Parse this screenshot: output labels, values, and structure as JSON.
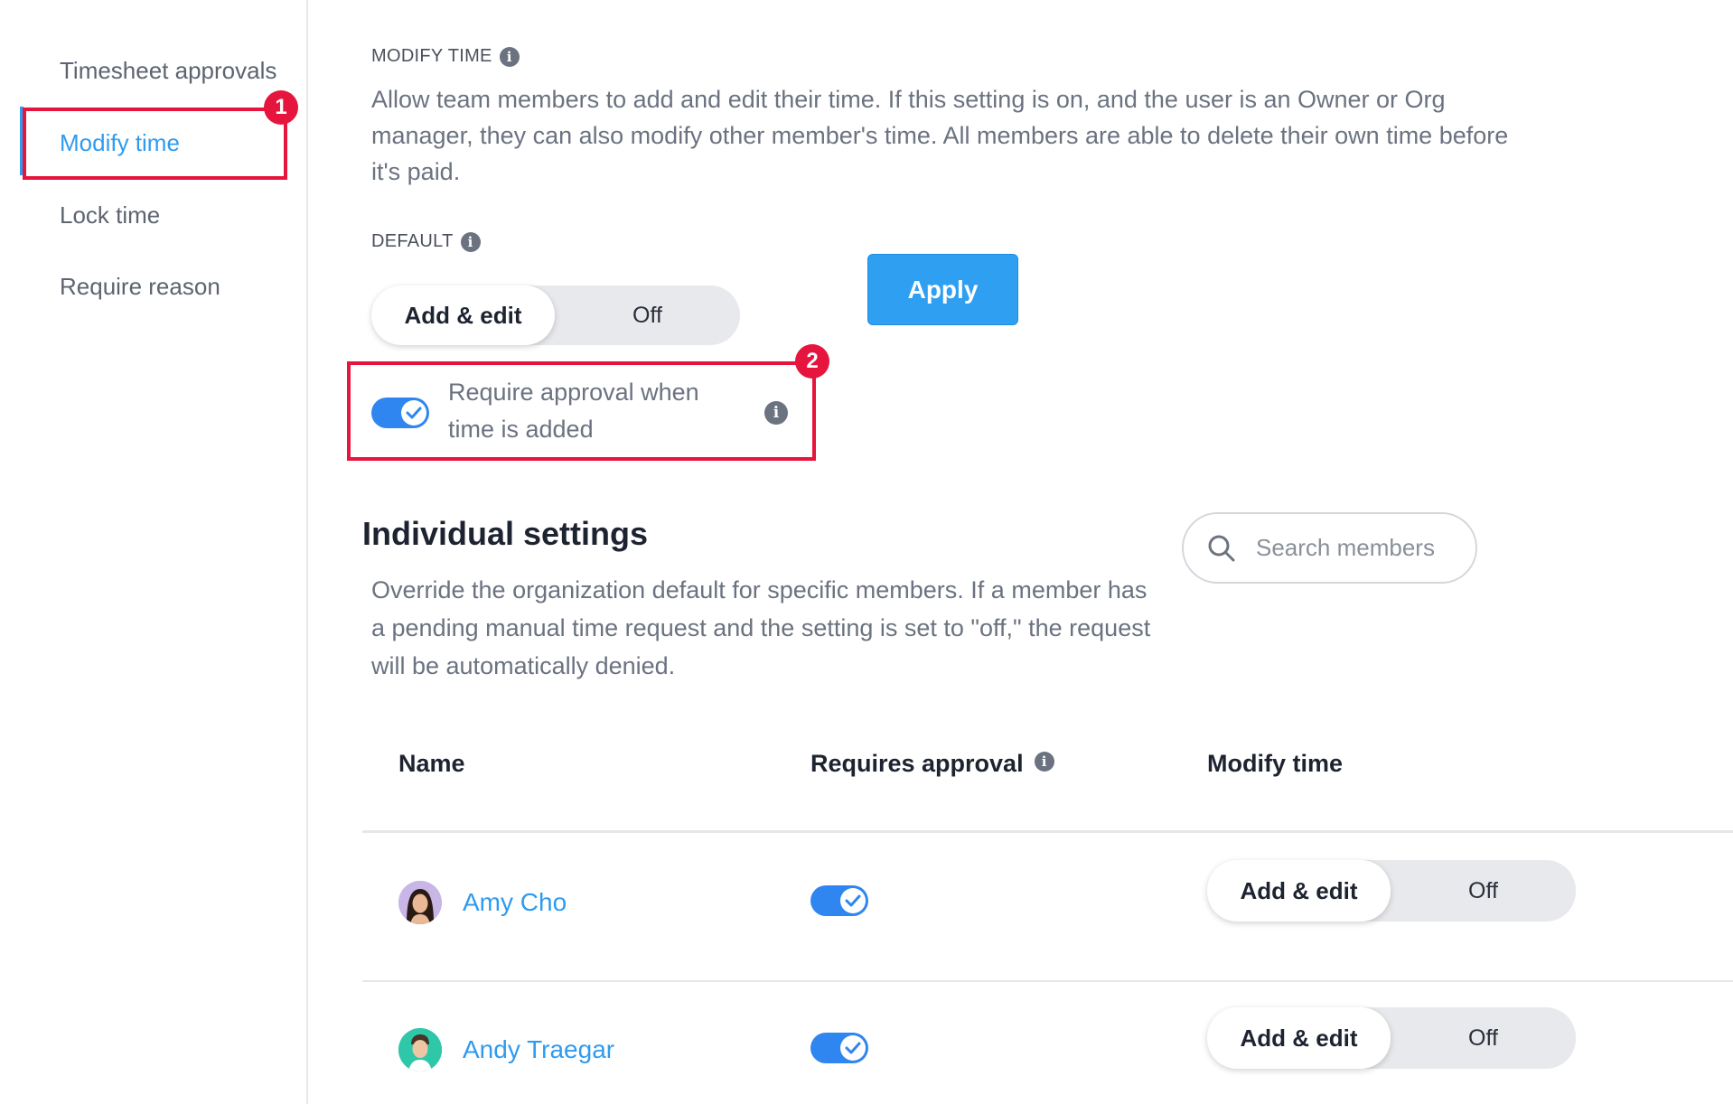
{
  "sidebar": {
    "items": [
      {
        "label": "Timesheet approvals"
      },
      {
        "label": "Modify time"
      },
      {
        "label": "Lock time"
      },
      {
        "label": "Require reason"
      }
    ],
    "active_index": 1
  },
  "annotations": {
    "badge_1": "1",
    "badge_2": "2"
  },
  "modify_time": {
    "title": "MODIFY TIME",
    "description": "Allow team members to add and edit their time. If this setting is on, and the user is an Owner or Org manager, they can also modify other member's time. All members are able to delete their own time before it's paid.",
    "default_label": "DEFAULT",
    "option_on": "Add & edit",
    "option_off": "Off",
    "apply_label": "Apply",
    "require_approval_line1": "Require approval when",
    "require_approval_line2": "time is added",
    "require_approval_enabled": true
  },
  "individual": {
    "title": "Individual settings",
    "description": "Override the organization default for specific members. If a member has a pending manual time request and the setting is set to \"off,\" the request will be automatically denied.",
    "search_placeholder": "Search members"
  },
  "table": {
    "headers": {
      "name": "Name",
      "requires_approval": "Requires approval",
      "modify_time": "Modify time"
    },
    "rows": [
      {
        "name": "Amy Cho",
        "requires_approval": true,
        "modify_on": "Add & edit",
        "modify_off": "Off"
      },
      {
        "name": "Andy Traegar",
        "requires_approval": true,
        "modify_on": "Add & edit",
        "modify_off": "Off"
      }
    ]
  },
  "colors": {
    "accent": "#2f9bf0",
    "toggle_on": "#2f86f0",
    "annotation": "#e6153d"
  },
  "icons": [
    "info-icon",
    "search-icon",
    "check-icon",
    "avatar"
  ]
}
